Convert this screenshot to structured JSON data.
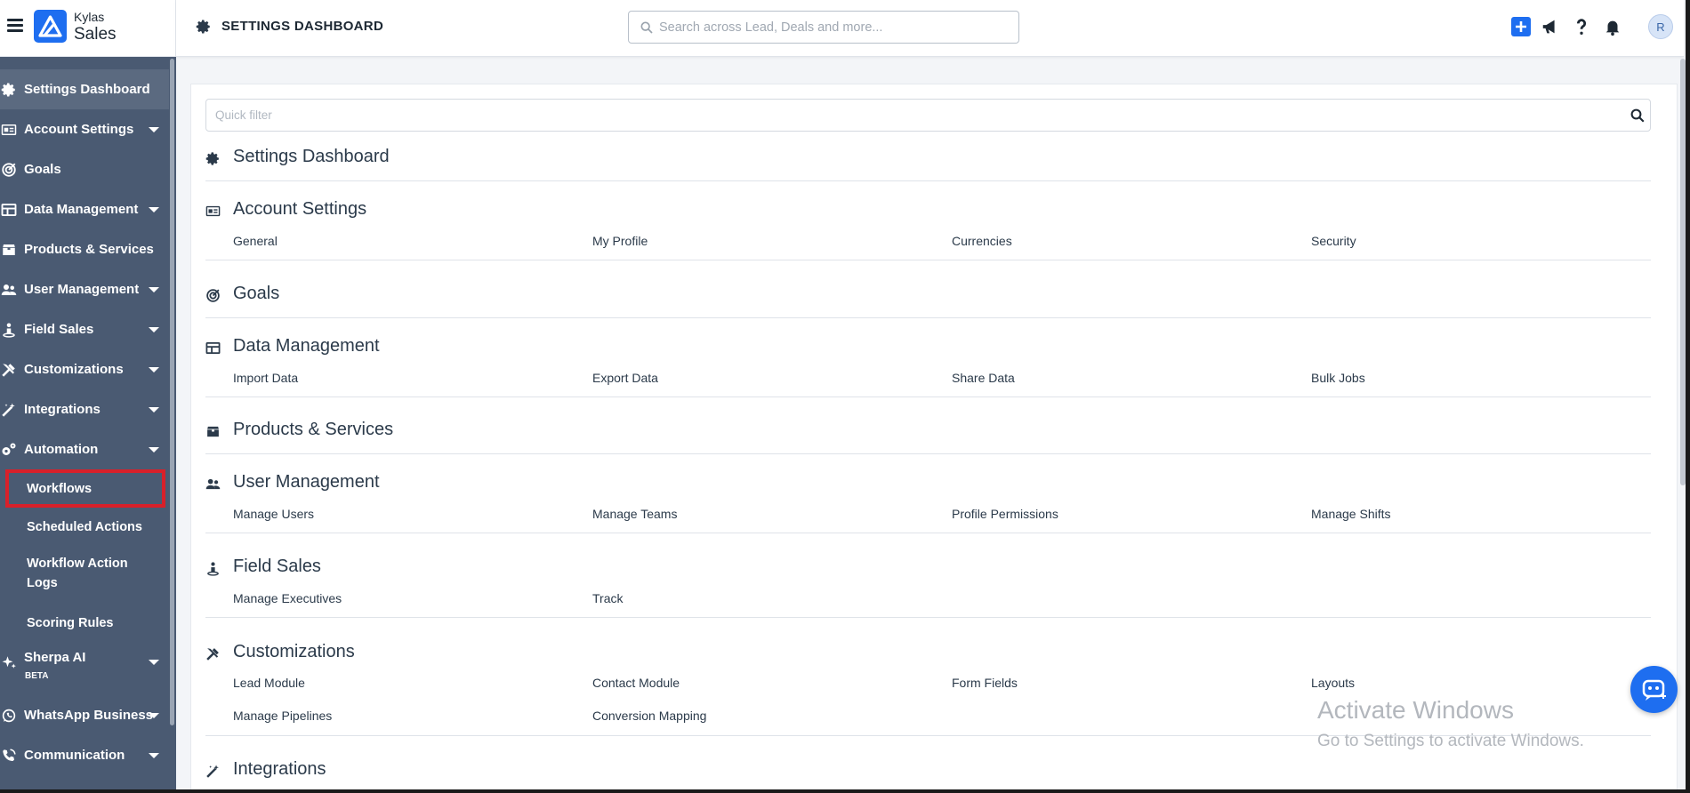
{
  "brand": {
    "small": "Kylas",
    "big": "Sales"
  },
  "topbar": {
    "title": "SETTINGS DASHBOARD",
    "search_placeholder": "Search across Lead, Deals and more...",
    "avatar": "R"
  },
  "sidebar": {
    "items": [
      {
        "label": "Settings Dashboard"
      },
      {
        "label": "Account Settings"
      },
      {
        "label": "Goals"
      },
      {
        "label": "Data Management"
      },
      {
        "label": "Products & Services"
      },
      {
        "label": "User Management"
      },
      {
        "label": "Field Sales"
      },
      {
        "label": "Customizations"
      },
      {
        "label": "Integrations"
      },
      {
        "label": "Automation"
      }
    ],
    "automation_sub": [
      "Workflows",
      "Scheduled Actions",
      "Workflow Action Logs",
      "Scoring Rules"
    ],
    "after": [
      {
        "label": "Sherpa AI",
        "badge": "BETA"
      },
      {
        "label": "WhatsApp Business"
      },
      {
        "label": "Communication"
      }
    ]
  },
  "main": {
    "quick_filter_placeholder": "Quick filter",
    "sections": [
      {
        "title": "Settings Dashboard",
        "links": []
      },
      {
        "title": "Account Settings",
        "links": [
          "General",
          "My Profile",
          "Currencies",
          "Security"
        ]
      },
      {
        "title": "Goals",
        "links": []
      },
      {
        "title": "Data Management",
        "links": [
          "Import Data",
          "Export Data",
          "Share Data",
          "Bulk Jobs"
        ]
      },
      {
        "title": "Products & Services",
        "links": []
      },
      {
        "title": "User Management",
        "links": [
          "Manage Users",
          "Manage Teams",
          "Profile Permissions",
          "Manage Shifts"
        ]
      },
      {
        "title": "Field Sales",
        "links": [
          "Manage Executives",
          "Track"
        ]
      },
      {
        "title": "Customizations",
        "links": [
          "Lead Module",
          "Contact Module",
          "Form Fields",
          "Layouts",
          "Manage Pipelines",
          "Conversion Mapping"
        ]
      },
      {
        "title": "Integrations",
        "links": []
      }
    ]
  },
  "watermark": {
    "line1": "Activate Windows",
    "line2": "Go to Settings to activate Windows."
  },
  "colors": {
    "sidebar": "#4a5a72",
    "accent": "#1e6ef0",
    "highlight": "#d8202a"
  }
}
